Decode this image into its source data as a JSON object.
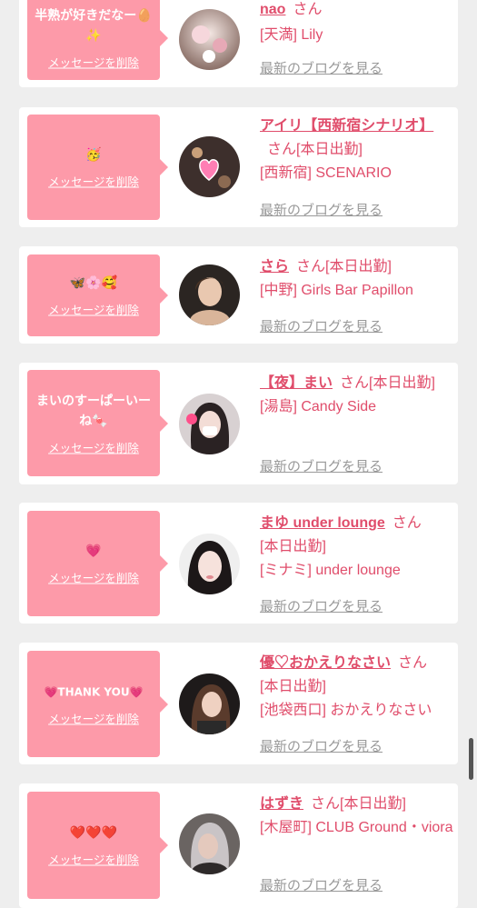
{
  "common": {
    "delete_label": "メッセージを削除",
    "blog_label": "最新のブログを見る",
    "san": "さん"
  },
  "colors": {
    "bubble": "#fd9aa9",
    "accent": "#e04d6b",
    "muted": "#999999"
  },
  "items": [
    {
      "message": "半熟が好きだなー🥚✨",
      "name": "nao",
      "status": "",
      "area": "[天満] Lily"
    },
    {
      "message": "🥳",
      "name": "アイリ【西新宿シナリオ】",
      "status": "[本日出勤]",
      "area": "[西新宿] SCENARIO"
    },
    {
      "message": "🦋🌸🥰",
      "name": "さら",
      "status": "[本日出勤]",
      "area": "[中野] Girls Bar Papillon"
    },
    {
      "message": "まいのすーぱーいーね🍬",
      "name": "【夜】まい",
      "status": "[本日出勤]",
      "area": "[湯島] Candy Side"
    },
    {
      "message": "💗",
      "name": "まゆ under lounge",
      "status": "[本日出勤]",
      "area": "[ミナミ] under lounge"
    },
    {
      "message": "💗THANK YOU💗",
      "name": "優♡おかえりなさい",
      "status": "[本日出勤]",
      "area": "[池袋西口] おかえりなさい"
    },
    {
      "message": "❤️❤️❤️",
      "name": "はずき",
      "status": "[本日出勤]",
      "area": "[木屋町] CLUB Ground・viora"
    }
  ]
}
